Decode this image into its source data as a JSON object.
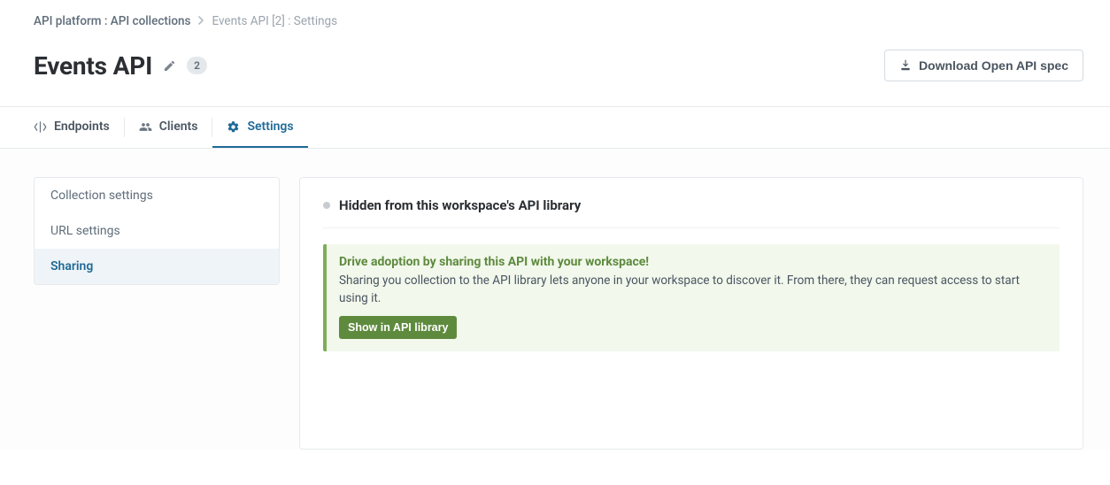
{
  "breadcrumb": {
    "root": "API platform : API collections",
    "current": "Events API [2] : Settings"
  },
  "header": {
    "title": "Events API",
    "badge": "2",
    "download_label": "Download Open API spec"
  },
  "tabs": {
    "endpoints": "Endpoints",
    "clients": "Clients",
    "settings": "Settings"
  },
  "sidebar": {
    "items": [
      {
        "label": "Collection settings"
      },
      {
        "label": "URL settings"
      },
      {
        "label": "Sharing"
      }
    ]
  },
  "section": {
    "title": "Hidden from this workspace's API library"
  },
  "notice": {
    "head": "Drive adoption by sharing this API with your workspace!",
    "body": "Sharing you collection to the API library lets anyone in your workspace to discover it. From there, they can request access to start using it.",
    "button": "Show in API library"
  }
}
